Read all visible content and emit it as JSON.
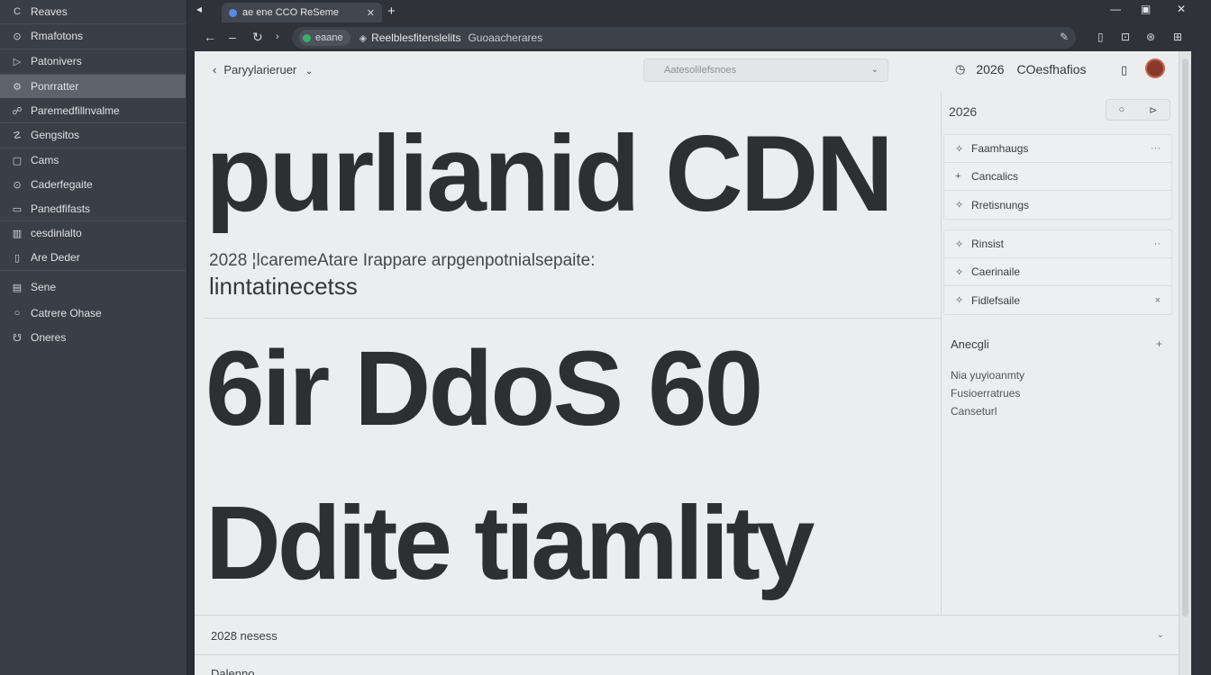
{
  "sidebar": {
    "items": [
      {
        "icon": "C",
        "label": "Reaves"
      },
      {
        "icon": "⊙",
        "label": "Rmafotons"
      },
      {
        "icon": "▷",
        "label": "Patonivers"
      },
      {
        "icon": "⚙",
        "label": "Ponrratter"
      },
      {
        "icon": "☍",
        "label": "Paremedfillnvalme"
      },
      {
        "icon": "☡",
        "label": "Gengsitos"
      },
      {
        "icon": "▢",
        "label": "Cams"
      },
      {
        "icon": "⊙",
        "label": "Caderfegaite"
      },
      {
        "icon": "▭",
        "label": "Panedfifasts"
      },
      {
        "icon": "▥",
        "label": "cesdinlalto"
      },
      {
        "icon": "▯",
        "label": "Are Deder"
      },
      {
        "icon": "▤",
        "label": "Sene"
      },
      {
        "icon": "○",
        "label": "Catrere Ohase"
      },
      {
        "icon": "☋",
        "label": "Oneres"
      }
    ]
  },
  "browser": {
    "tab_title": "ae ene CCO ReSeme",
    "omnibox_chip": "eaane",
    "url_host": "Reelblesfitenslelits",
    "url_path": "Guoaacherares"
  },
  "page": {
    "breadcrumb": "Paryylarieruer",
    "search_placeholder": "Aatesolilefsnoes",
    "header_year": "2026",
    "header_label": "COesfhafios",
    "hero_line_1": "purlianid CDN",
    "sub_line_1": "2028 ¦lcaremeAtare Irappare arpgenpotnialsepaite:",
    "sub_line_2": "linntatinecetss",
    "hero_line_2": "6ir DdoS 60",
    "hero_line_3": "Ddite tiamlity",
    "footer_row": "2028 nesess",
    "footer_row_2": "Dalenno"
  },
  "panel": {
    "year": "2026",
    "btn_a": "○",
    "btn_b": "⊳",
    "group1": [
      {
        "icon": "✧",
        "label": "Faamhaugs"
      },
      {
        "icon": "+",
        "label": "Cancalics"
      },
      {
        "icon": "✧",
        "label": "Rretisnungs"
      }
    ],
    "group2": [
      {
        "icon": "✧",
        "label": "Rinsist"
      },
      {
        "icon": "✧",
        "label": "Caerinaile"
      },
      {
        "icon": "✧",
        "label": "Fidlefsaile"
      }
    ],
    "section_title": "Anecgli",
    "section_lines": [
      "Nia yuyioanmty",
      "Fusioerratrues",
      "Canseturl"
    ]
  },
  "colors": {
    "accent": "#37b26c",
    "sidebar_bg": "#3a3e46",
    "page_bg": "#ecedee",
    "hero_text": "#2d2f33"
  }
}
